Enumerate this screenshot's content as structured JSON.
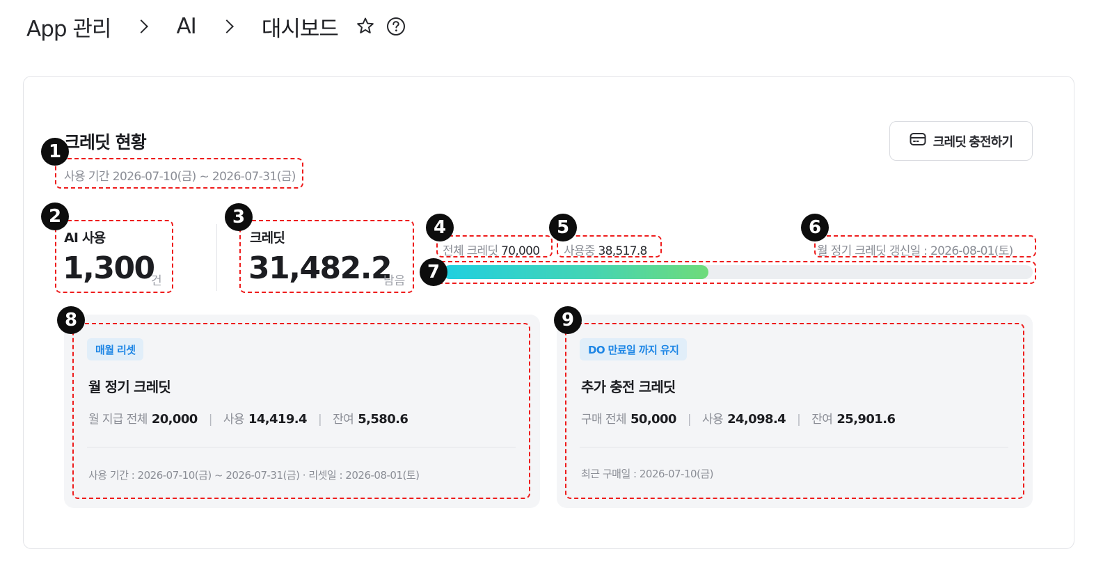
{
  "breadcrumb": {
    "items": [
      "App 관리",
      "AI"
    ],
    "current": "대시보드"
  },
  "icons": {
    "favorite": "star-icon",
    "help": "help-icon",
    "card": "credit-card-icon"
  },
  "section": {
    "title": "크레딧 현황",
    "period": "사용 기간 2026-07-10(금) ~ 2026-07-31(금)",
    "charge_button": "크레딧 충전하기"
  },
  "stats": {
    "ai_usage_label": "AI 사용",
    "ai_usage_value": "1,300",
    "ai_usage_unit": "건",
    "credit_label": "크레딧",
    "credit_value": "31,482.2",
    "credit_unit": "남음"
  },
  "meta": {
    "total_label": "전체 크레딧",
    "total_value": "70,000",
    "used_label": "사용중",
    "used_value": "38,517.8",
    "renewal": "월 정기 크레딧 갱신일 : 2026-08-01(토)"
  },
  "progress": {
    "remaining_fraction": 0.45
  },
  "markers": [
    "1",
    "2",
    "3",
    "4",
    "5",
    "6",
    "7",
    "8",
    "9"
  ],
  "monthly": {
    "badge": "매월 리셋",
    "title": "월 정기 크레딧",
    "total_label": "월 지급 전체",
    "total_value": "20,000",
    "used_label": "사용",
    "used_value": "14,419.4",
    "remain_label": "잔여",
    "remain_value": "5,580.6",
    "footer": "사용 기간 : 2026-07-10(금) ~ 2026-07-31(금)   ·   리셋일 : 2026-08-01(토)"
  },
  "extra": {
    "badge": "DO 만료일 까지 유지",
    "title": "추가 충전 크레딧",
    "total_label": "구매 전체",
    "total_value": "50,000",
    "used_label": "사용",
    "used_value": "24,098.4",
    "remain_label": "잔여",
    "remain_value": "25,901.6",
    "footer": "최근 구매일 : 2026-07-10(금)"
  },
  "colors": {
    "accent_blue": "#1e86e5",
    "progress_start": "#20cfe0",
    "progress_end": "#6fdb7a",
    "annotation": "#ee1c1c"
  }
}
